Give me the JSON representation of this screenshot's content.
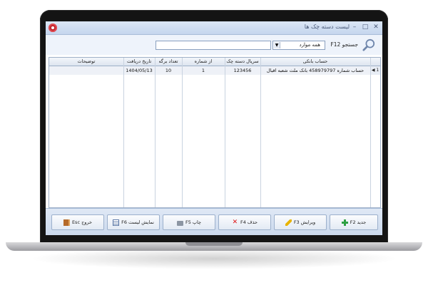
{
  "window": {
    "title": "لیست دسته چک ها",
    "controls": {
      "minimize": "–",
      "maximize": "□",
      "close": "✕"
    }
  },
  "search": {
    "label": "جستجو F12",
    "filter_selected": "همه موارد",
    "dropdown_arrow": "▼",
    "query": ""
  },
  "table": {
    "columns": [
      "حساب بانکی",
      "سریال دسته چک",
      "از شماره",
      "تعداد برگه",
      "تاریخ دریافت",
      "توضیحات"
    ],
    "rows": [
      {
        "bank_account": "حساب شماره 458979797 بانک ملت شعبه اقبال",
        "serial": "123456",
        "from_number": "1",
        "leaf_count": "10",
        "received_date": "1404/05/13",
        "description": ""
      }
    ],
    "row_indicator": "◀ 1"
  },
  "toolbar": {
    "new_label": "جدید F2",
    "edit_label": "ویرایش F3",
    "delete_label": "حذف F4",
    "print_label": "چاپ F5",
    "show_list_label": "نمایش لیست F6",
    "exit_label": "خروج Esc"
  },
  "colors": {
    "titlebar": "#c5d6ee",
    "toolbar": "#cbd9ed",
    "accent_plus": "#2ea043",
    "accent_delete": "#dd1111"
  },
  "icons": [
    "app-icon",
    "search-icon",
    "plus-icon",
    "pencil-icon",
    "x-icon",
    "printer-icon",
    "list-icon",
    "door-icon"
  ]
}
